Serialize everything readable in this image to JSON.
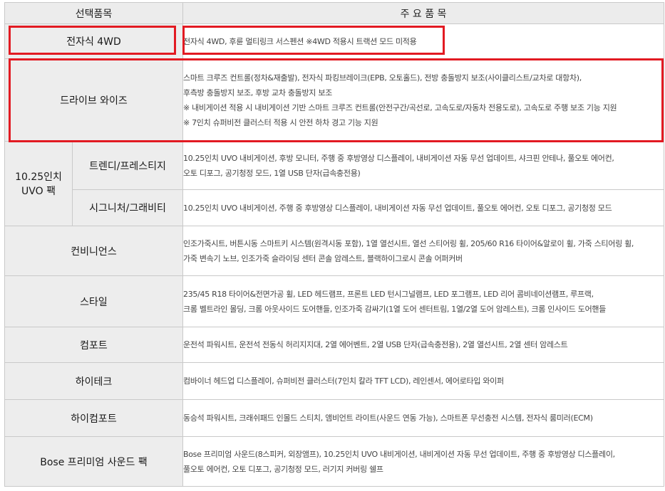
{
  "header": {
    "col1": "선택품목",
    "col2": "주 요 품 목"
  },
  "rows": {
    "awd": {
      "name": "전자식 4WD",
      "lines": [
        "전자식 4WD, 후륜 멀티링크 서스펜션 ※4WD 적용시 트랙션 모드 미적용"
      ]
    },
    "drive": {
      "name": "드라이브 와이즈",
      "lines": [
        "스마트 크루즈 컨트롤(정차&재출발), 전자식 파킹브레이크(EPB, 오토홀드), 전방 충돌방지 보조(사이클리스트/교차로 대항차),",
        "후측방 충돌방지 보조, 후방 교차 충돌방지 보조",
        "※ 내비게이션 적용 시 내비게이션 기반 스마트 크루즈 컨트롤(안전구간/곡선로, 고속도로/자동차 전용도로), 고속도로 주행 보조 기능 지원",
        "※ 7인치 슈퍼비전 클러스터 적용 시 안전 하차 경고 기능 지원"
      ]
    },
    "uvo": {
      "name_line1": "10.25인치",
      "name_line2": "UVO 팩",
      "trendy": {
        "name": "트렌디/프레스티지",
        "lines": [
          "10.25인치 UVO 내비게이션, 후방 모니터, 주행 중 후방영상 디스플레이, 내비게이션 자동 무선 업데이트, 샤크핀 안테나, 풀오토 에어컨,",
          "오토 디포그, 공기청정 모드, 1열 USB 단자(급속충전용)"
        ]
      },
      "signature": {
        "name": "시그니처/그래비티",
        "lines": [
          "10.25인치 UVO 내비게이션, 주행 중 후방영상 디스플레이, 내비게이션 자동 무선 업데이트, 풀오토 에어컨, 오토 디포그, 공기청정 모드"
        ]
      }
    },
    "convenience": {
      "name": "컨비니언스",
      "lines": [
        "인조가죽시트, 버튼시동 스마트키 시스템(원격시동 포함), 1열 열선시트, 열선 스티어링 휠, 205/60 R16 타이어&알로이 휠, 가죽 스티어링 휠,",
        "가죽 변속기 노브, 인조가죽 슬라이딩 센터 콘솔 암레스트, 블랙하이그로시 콘솔 어퍼커버"
      ]
    },
    "style": {
      "name": "스타일",
      "lines": [
        "235/45 R18 타이어&전면가공 휠, LED 헤드램프, 프론트 LED 턴시그널램프, LED 포그램프, LED 리어 콤비네이션램프, 루프랙,",
        "크롬 벨트라인 몰딩, 크롬 아웃사이드 도어핸들, 인조가죽 감싸기(1열 도어 센터트림, 1열/2열 도어 암레스트), 크롬 인사이드 도어핸들"
      ]
    },
    "comfort": {
      "name": "컴포트",
      "lines": [
        "운전석 파워시트, 운전석 전동식 허리지지대, 2열 에어벤트, 2열 USB 단자(급속충전용), 2열 열선시트, 2열 센터 암레스트"
      ]
    },
    "hitech": {
      "name": "하이테크",
      "lines": [
        "컴바이너 헤드업 디스플레이, 슈퍼비전 클러스터(7인치 칼라 TFT LCD), 레인센서, 에어로타입 와이퍼"
      ]
    },
    "hicomfort": {
      "name": "하이컴포트",
      "lines": [
        "동승석 파워시트, 크래쉬패드 인몰드 스티치, 앰비언트 라이트(사운드 연동 가능), 스마트폰 무선충전 시스템, 전자식 룸미러(ECM)"
      ]
    },
    "bose": {
      "name": "Bose 프리미엄 사운드 팩",
      "lines": [
        "Bose 프리미엄 사운드(8스피커, 외장앰프), 10.25인치 UVO 내비게이션, 내비게이션 자동 무선 업데이트, 주행 중 후방영상 디스플레이,",
        "풀오토 에어컨, 오토 디포그, 공기청정 모드, 러기지 커버링 쉘프"
      ]
    }
  },
  "colors": {
    "highlight": "#e21a22",
    "category_bg": "#ededed",
    "border": "#c9c9c9"
  }
}
